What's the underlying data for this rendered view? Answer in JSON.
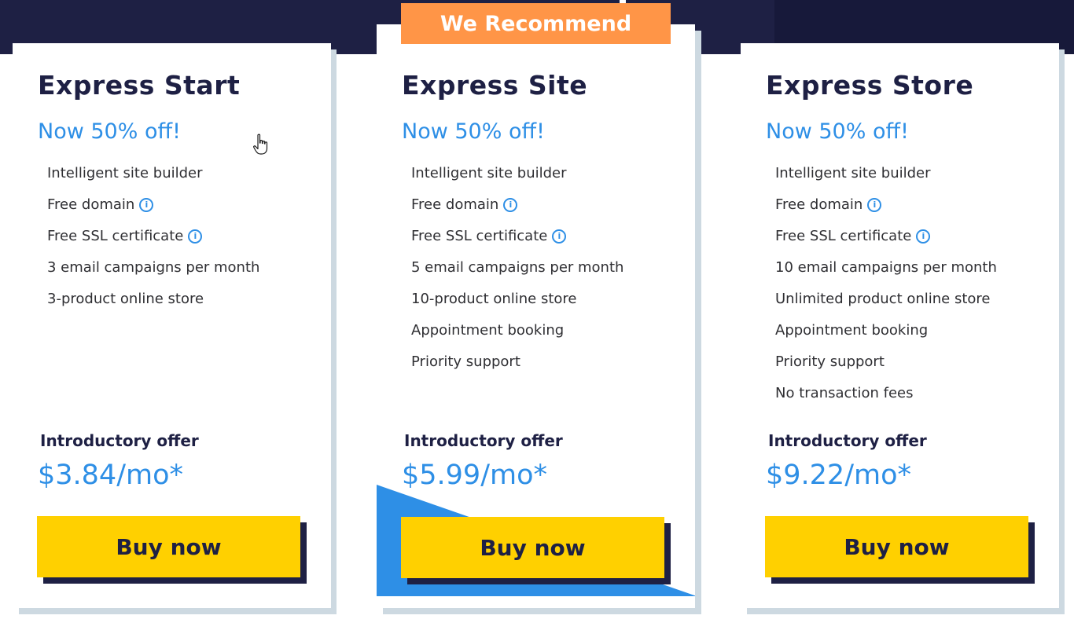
{
  "colors": {
    "navy": "#1e2044",
    "accent_blue": "#2e8fe6",
    "buy_yellow": "#ffd000",
    "badge_orange": "#ff9547",
    "card_shadow": "#cdd9e1"
  },
  "recommend_badge": "We Recommend",
  "icons": {
    "info": "info-circle-icon",
    "cursor": "hand-pointer-cursor-icon"
  },
  "plans": [
    {
      "title": "Express Start",
      "discount": "Now 50% off!",
      "features": [
        {
          "label": "Intelligent site builder",
          "info": false
        },
        {
          "label": "Free domain",
          "info": true
        },
        {
          "label": "Free SSL certificate",
          "info": true
        },
        {
          "label": "3 email campaigns per month",
          "info": false
        },
        {
          "label": "3-product online store",
          "info": false
        }
      ],
      "offer_label": "Introductory offer",
      "price": "$3.84/mo*",
      "buy_label": "Buy now",
      "recommended": false
    },
    {
      "title": "Express Site",
      "discount": "Now 50% off!",
      "features": [
        {
          "label": "Intelligent site builder",
          "info": false
        },
        {
          "label": "Free domain",
          "info": true
        },
        {
          "label": "Free SSL certificate",
          "info": true
        },
        {
          "label": "5 email campaigns per month",
          "info": false
        },
        {
          "label": "10-product online store",
          "info": false
        },
        {
          "label": "Appointment booking",
          "info": false
        },
        {
          "label": "Priority support",
          "info": false
        }
      ],
      "offer_label": "Introductory offer",
      "price": "$5.99/mo*",
      "buy_label": "Buy now",
      "recommended": true
    },
    {
      "title": "Express Store",
      "discount": "Now 50% off!",
      "features": [
        {
          "label": "Intelligent site builder",
          "info": false
        },
        {
          "label": "Free domain",
          "info": true
        },
        {
          "label": "Free SSL certificate",
          "info": true
        },
        {
          "label": "10 email campaigns per month",
          "info": false
        },
        {
          "label": "Unlimited product online store",
          "info": false
        },
        {
          "label": "Appointment booking",
          "info": false
        },
        {
          "label": "Priority support",
          "info": false
        },
        {
          "label": "No transaction fees",
          "info": false
        }
      ],
      "offer_label": "Introductory offer",
      "price": "$9.22/mo*",
      "buy_label": "Buy now",
      "recommended": false
    }
  ]
}
